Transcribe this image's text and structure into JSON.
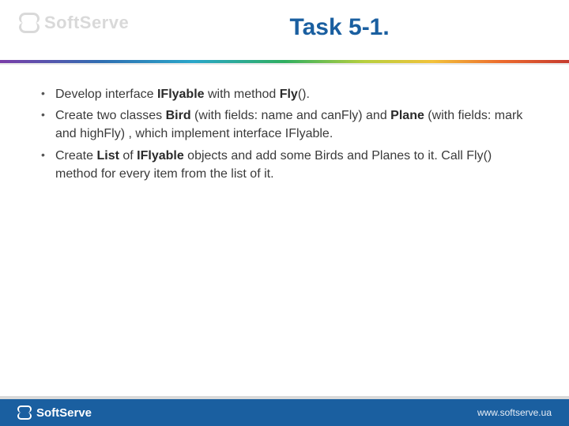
{
  "header": {
    "logo_text": "SoftServe",
    "title": "Task 5-1."
  },
  "bullets": [
    {
      "pre": "Develop interface ",
      "b1": "IFlyable",
      "mid1": " with method ",
      "b2": "Fly",
      "post": "()."
    },
    {
      "pre": "Create two classes ",
      "b1": "Bird",
      "mid1": " (with fields: name and canFly) and ",
      "b2": "Plane",
      "post": "  (with fields: mark and highFly) , which implement interface IFlyable."
    },
    {
      "pre": "Create ",
      "b1": "List",
      "mid1": " of ",
      "b2": "IFlyable",
      "post": " objects and add some Birds and Planes to it. Call Fly() method for every item from the list of it."
    }
  ],
  "footer": {
    "logo_text": "SoftServe",
    "url": "www.softserve.ua"
  }
}
